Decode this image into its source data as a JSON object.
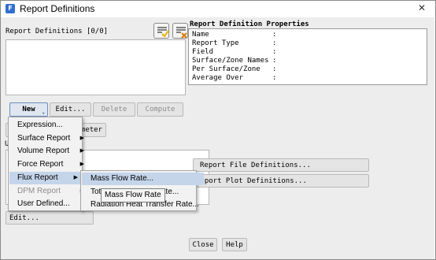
{
  "window": {
    "title": "Report Definitions",
    "close_glyph": "✕"
  },
  "left": {
    "list_label": "Report Definitions [0/0]",
    "buttons": {
      "new": "New",
      "edit": "Edit...",
      "delete": "Delete",
      "compute": "Compute"
    },
    "second_row_visible_text": "meter",
    "section_label_visible": "U",
    "bottom_edit": "Edit..."
  },
  "props": {
    "title": "Report Definition Properties",
    "rows": [
      {
        "name": "Name",
        "sep": ":"
      },
      {
        "name": "Report Type",
        "sep": ":"
      },
      {
        "name": "Field",
        "sep": ":"
      },
      {
        "name": "Surface/Zone Names",
        "sep": ":"
      },
      {
        "name": "Per Surface/Zone",
        "sep": ":"
      },
      {
        "name": "Average Over",
        "sep": ":"
      }
    ]
  },
  "right_buttons": {
    "file_defs": "Report File Definitions...",
    "plot_defs": "Report Plot Definitions..."
  },
  "footer": {
    "close": "Close",
    "help": "Help"
  },
  "menu": {
    "items": [
      {
        "label": "Expression...",
        "submenu": false
      },
      {
        "label": "Surface Report",
        "submenu": true
      },
      {
        "label": "Volume Report",
        "submenu": true
      },
      {
        "label": "Force Report",
        "submenu": true
      },
      {
        "label": "Flux Report",
        "submenu": true
      },
      {
        "label": "DPM Report",
        "submenu": true
      },
      {
        "label": "User Defined...",
        "submenu": false
      }
    ],
    "submenu_arrow": "▶",
    "selected": "Flux Report",
    "disabled": "DPM Report"
  },
  "submenu": {
    "items": [
      {
        "label": "Mass Flow Rate..."
      },
      {
        "label": "Tot",
        "hidden_suffix": "ate..."
      },
      {
        "label": "Radiation Heat Transfer Rate..."
      }
    ]
  },
  "tooltip": {
    "text": "Mass Flow Rate"
  },
  "icons": {
    "app": "fluent-app-icon",
    "select_all": "select-all-icon",
    "deselect_all": "deselect-all-icon"
  },
  "colors": {
    "selection": "#c4d5ea",
    "check_yellow": "#e8b400",
    "check_green": "#2e8b2e",
    "x_orange": "#e07b00"
  }
}
